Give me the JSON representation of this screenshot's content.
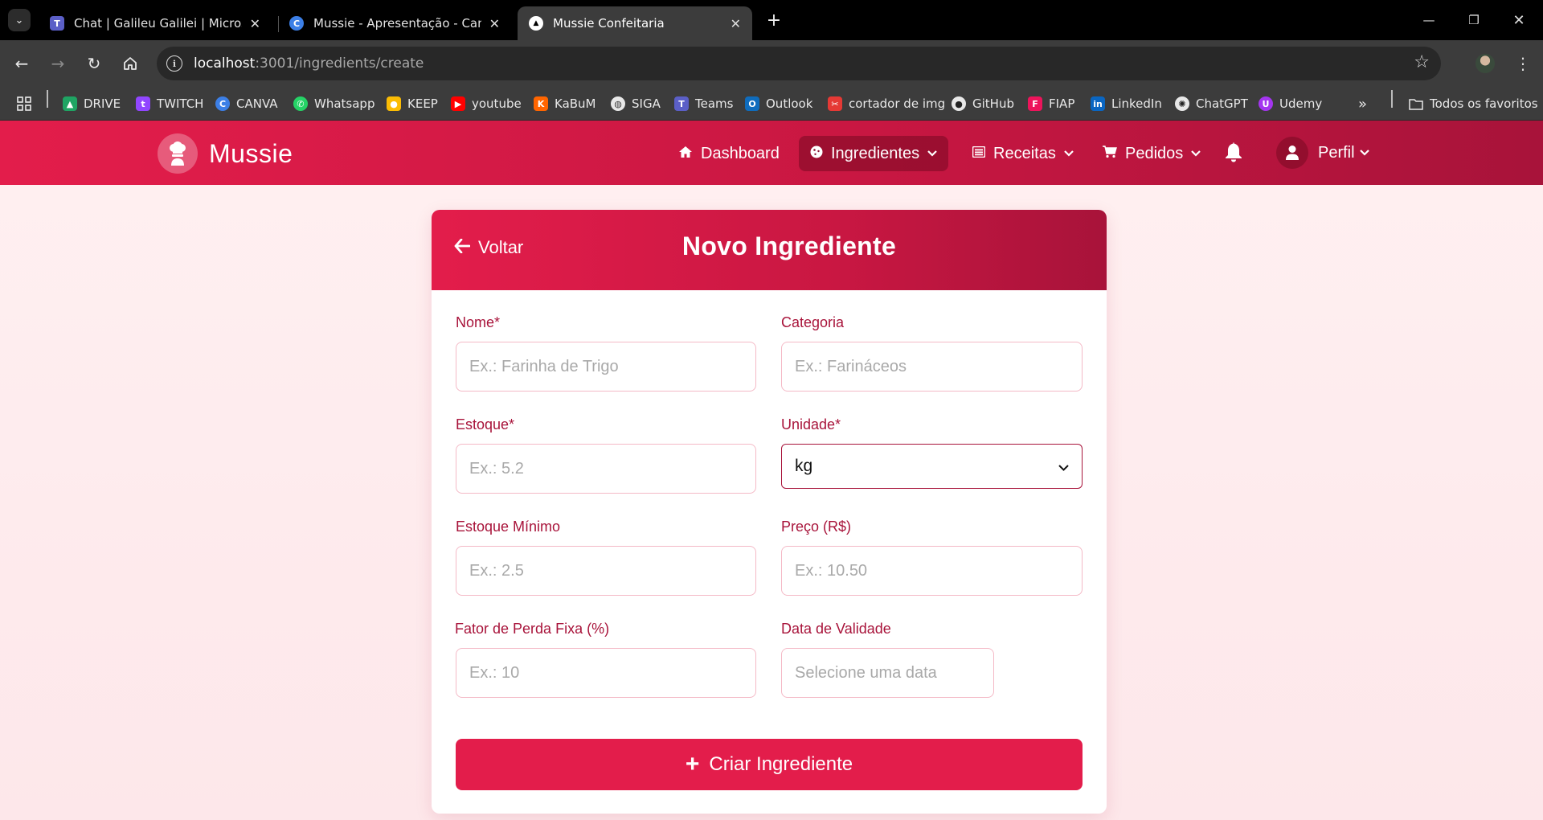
{
  "browser": {
    "tabs": [
      {
        "title": "Chat | Galileu Galilei | Microsoft",
        "icon": "teams-icon",
        "color": "#5b5fc7"
      },
      {
        "title": "Mussie - Apresentação - Canva",
        "icon": "canva-icon",
        "color": "#3c7fe6"
      },
      {
        "title": "Mussie Confeitaria",
        "icon": "app-icon",
        "color": "#ffffff"
      }
    ],
    "url_host": "localhost",
    "url_path": ":3001/ingredients/create",
    "bookmarks": [
      {
        "label": "DRIVE",
        "color": "#1fa463"
      },
      {
        "label": "TWITCH",
        "color": "#9146ff"
      },
      {
        "label": "CANVA",
        "color": "#3c7fe6"
      },
      {
        "label": "Whatsapp",
        "color": "#25d366"
      },
      {
        "label": "KEEP",
        "color": "#fbbc04"
      },
      {
        "label": "youtube",
        "color": "#ff0000"
      },
      {
        "label": "KaBuM",
        "color": "#ff6500"
      },
      {
        "label": "SIGA",
        "color": "#e8e8e8"
      },
      {
        "label": "Teams",
        "color": "#5b5fc7"
      },
      {
        "label": "Outlook",
        "color": "#0f6cbd"
      },
      {
        "label": "cortador de img",
        "color": "#e53935"
      },
      {
        "label": "GitHub",
        "color": "#e8e8e8"
      },
      {
        "label": "FIAP",
        "color": "#ed145b"
      },
      {
        "label": "LinkedIn",
        "color": "#0a66c2"
      },
      {
        "label": "ChatGPT",
        "color": "#e8e8e8"
      },
      {
        "label": "Udemy",
        "color": "#a435f0"
      }
    ],
    "all_bookmarks": "Todos os favoritos"
  },
  "app": {
    "brand": "Mussie",
    "nav": {
      "dashboard": "Dashboard",
      "ingredientes": "Ingredientes",
      "receitas": "Receitas",
      "pedidos": "Pedidos",
      "perfil": "Perfil"
    },
    "accent": "#e31d4b",
    "accent_dark": "#a8133a"
  },
  "form": {
    "back": "Voltar",
    "title": "Novo Ingrediente",
    "fields": {
      "nome": {
        "label": "Nome*",
        "placeholder": "Ex.: Farinha de Trigo"
      },
      "categoria": {
        "label": "Categoria",
        "placeholder": "Ex.: Farináceos"
      },
      "estoque": {
        "label": "Estoque*",
        "placeholder": "Ex.: 5.2"
      },
      "unidade": {
        "label": "Unidade*",
        "value": "kg"
      },
      "estoque_minimo": {
        "label": "Estoque Mínimo",
        "placeholder": "Ex.: 2.5"
      },
      "preco": {
        "label": "Preço (R$)",
        "placeholder": "Ex.: 10.50"
      },
      "fator_perda": {
        "label": "Fator de Perda Fixa (%)",
        "placeholder": "Ex.: 10"
      },
      "validade": {
        "label": "Data de Validade",
        "placeholder": "Selecione uma data"
      }
    },
    "submit": "Criar Ingrediente"
  }
}
